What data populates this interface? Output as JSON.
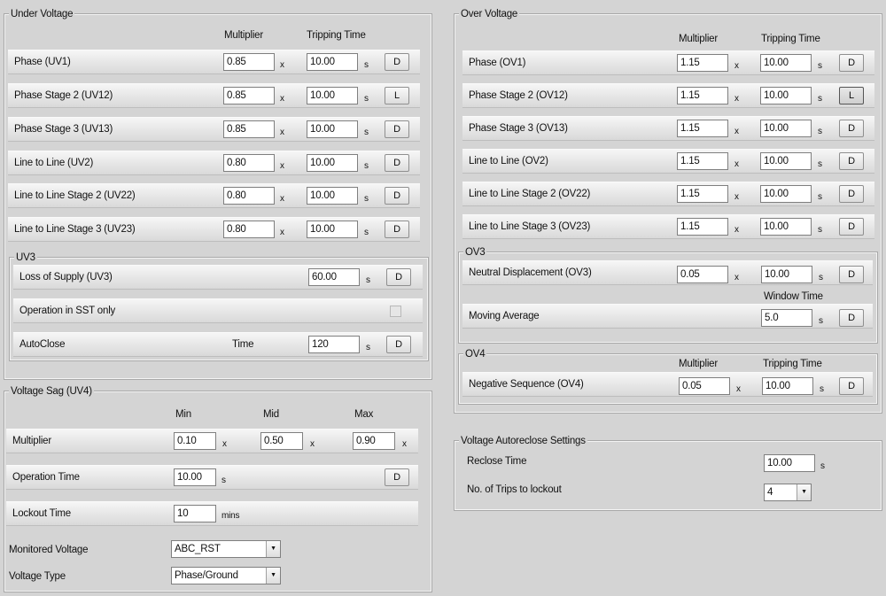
{
  "under_voltage": {
    "title": "Under Voltage",
    "col_multiplier": "Multiplier",
    "col_tripping": "Tripping Time",
    "rows": [
      {
        "label": "Phase (UV1)",
        "mult": "0.85",
        "time": "10.00",
        "btn": "D"
      },
      {
        "label": "Phase Stage 2 (UV12)",
        "mult": "0.85",
        "time": "10.00",
        "btn": "L"
      },
      {
        "label": "Phase Stage 3 (UV13)",
        "mult": "0.85",
        "time": "10.00",
        "btn": "D"
      },
      {
        "label": "Line to Line (UV2)",
        "mult": "0.80",
        "time": "10.00",
        "btn": "D"
      },
      {
        "label": "Line to Line Stage 2 (UV22)",
        "mult": "0.80",
        "time": "10.00",
        "btn": "D"
      },
      {
        "label": "Line to Line Stage 3 (UV23)",
        "mult": "0.80",
        "time": "10.00",
        "btn": "D"
      }
    ],
    "unit_x": "x",
    "unit_s": "s",
    "uv3": {
      "title": "UV3",
      "loss_label": "Loss of Supply (UV3)",
      "loss_value": "60.00",
      "loss_btn": "D",
      "sst_label": "Operation in SST only",
      "autoclose_label": "AutoClose",
      "time_label": "Time",
      "autoclose_value": "120",
      "autoclose_btn": "D"
    }
  },
  "voltage_sag": {
    "title": "Voltage Sag (UV4)",
    "col_min": "Min",
    "col_mid": "Mid",
    "col_max": "Max",
    "multiplier_label": "Multiplier",
    "min": "0.10",
    "mid": "0.50",
    "max": "0.90",
    "operation_label": "Operation Time",
    "operation_value": "10.00",
    "operation_btn": "D",
    "lockout_label": "Lockout Time",
    "lockout_value": "10",
    "lockout_unit": "mins",
    "monitored_label": "Monitored Voltage",
    "monitored_value": "ABC_RST",
    "type_label": "Voltage Type",
    "type_value": "Phase/Ground"
  },
  "over_voltage": {
    "title": "Over Voltage",
    "col_multiplier": "Multiplier",
    "col_tripping": "Tripping Time",
    "rows": [
      {
        "label": "Phase (OV1)",
        "mult": "1.15",
        "time": "10.00",
        "btn": "D"
      },
      {
        "label": "Phase Stage 2 (OV12)",
        "mult": "1.15",
        "time": "10.00",
        "btn": "L"
      },
      {
        "label": "Phase Stage 3 (OV13)",
        "mult": "1.15",
        "time": "10.00",
        "btn": "D"
      },
      {
        "label": "Line to Line (OV2)",
        "mult": "1.15",
        "time": "10.00",
        "btn": "D"
      },
      {
        "label": "Line to Line Stage 2 (OV22)",
        "mult": "1.15",
        "time": "10.00",
        "btn": "D"
      },
      {
        "label": "Line to Line Stage 3 (OV23)",
        "mult": "1.15",
        "time": "10.00",
        "btn": "D"
      }
    ],
    "ov3": {
      "title": "OV3",
      "neutral_label": "Neutral Displacement (OV3)",
      "neutral_mult": "0.05",
      "neutral_time": "10.00",
      "neutral_btn": "D",
      "window_label": "Window Time",
      "moving_label": "Moving Average",
      "moving_value": "5.0",
      "moving_btn": "D"
    },
    "ov4": {
      "title": "OV4",
      "col_multiplier": "Multiplier",
      "col_tripping": "Tripping Time",
      "neg_label": "Negative Sequence (OV4)",
      "neg_mult": "0.05",
      "neg_time": "10.00",
      "neg_btn": "D"
    }
  },
  "autoreclose": {
    "title": "Voltage Autoreclose Settings",
    "reclose_label": "Reclose Time",
    "reclose_value": "10.00",
    "trips_label": "No. of Trips to lockout",
    "trips_value": "4"
  }
}
